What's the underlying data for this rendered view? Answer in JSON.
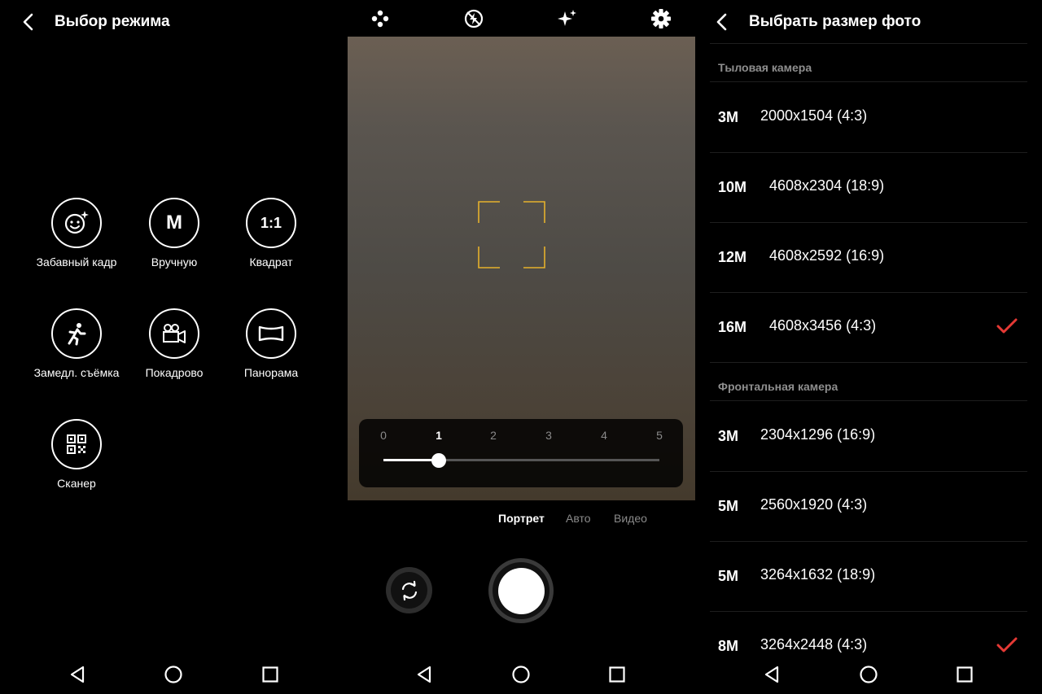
{
  "mode_screen": {
    "title": "Выбор режима",
    "modes": [
      {
        "label": "Забавный кадр",
        "icon": "smiley-sparkle-icon"
      },
      {
        "label": "Вручную",
        "icon": "manual-m-icon",
        "glyph": "M"
      },
      {
        "label": "Квадрат",
        "icon": "square-ratio-icon",
        "glyph": "1:1"
      },
      {
        "label": "Замедл. съёмка",
        "icon": "running-person-icon"
      },
      {
        "label": "Покадрово",
        "icon": "movie-camera-icon"
      },
      {
        "label": "Панорама",
        "icon": "panorama-icon"
      },
      {
        "label": "Сканер",
        "icon": "qr-code-icon"
      }
    ]
  },
  "camera_screen": {
    "top_icons": [
      "filter-dots-icon",
      "flash-auto-icon",
      "beauty-sparkle-icon",
      "settings-gear-icon"
    ],
    "zoom": {
      "ticks": [
        "0",
        "1",
        "2",
        "3",
        "4",
        "5"
      ],
      "value": 1,
      "max": 5
    },
    "mode_tabs": [
      {
        "label": "Портрет",
        "active": true
      },
      {
        "label": "Авто",
        "active": false
      },
      {
        "label": "Видео",
        "active": false
      }
    ],
    "focus_color": "#e5b12c"
  },
  "photo_size_screen": {
    "title": "Выбрать размер фото",
    "rear_section": "Тыловая камера",
    "front_section": "Фронтальная камера",
    "rear_sizes": [
      {
        "mp": "3M",
        "res": "2000x1504 (4:3)",
        "selected": false
      },
      {
        "mp": "10M",
        "res": "4608x2304 (18:9)",
        "selected": false
      },
      {
        "mp": "12M",
        "res": "4608x2592 (16:9)",
        "selected": false
      },
      {
        "mp": "16M",
        "res": "4608x3456 (4:3)",
        "selected": true
      }
    ],
    "front_sizes": [
      {
        "mp": "3M",
        "res": "2304x1296 (16:9)",
        "selected": false
      },
      {
        "mp": "5M",
        "res": "2560x1920 (4:3)",
        "selected": false
      },
      {
        "mp": "5M",
        "res": "3264x1632 (18:9)",
        "selected": false
      },
      {
        "mp": "8M",
        "res": "3264x2448 (4:3)",
        "selected": true
      }
    ],
    "check_color": "#e53935"
  },
  "nav_icons": [
    "back-triangle-icon",
    "home-circle-icon",
    "recents-square-icon"
  ]
}
